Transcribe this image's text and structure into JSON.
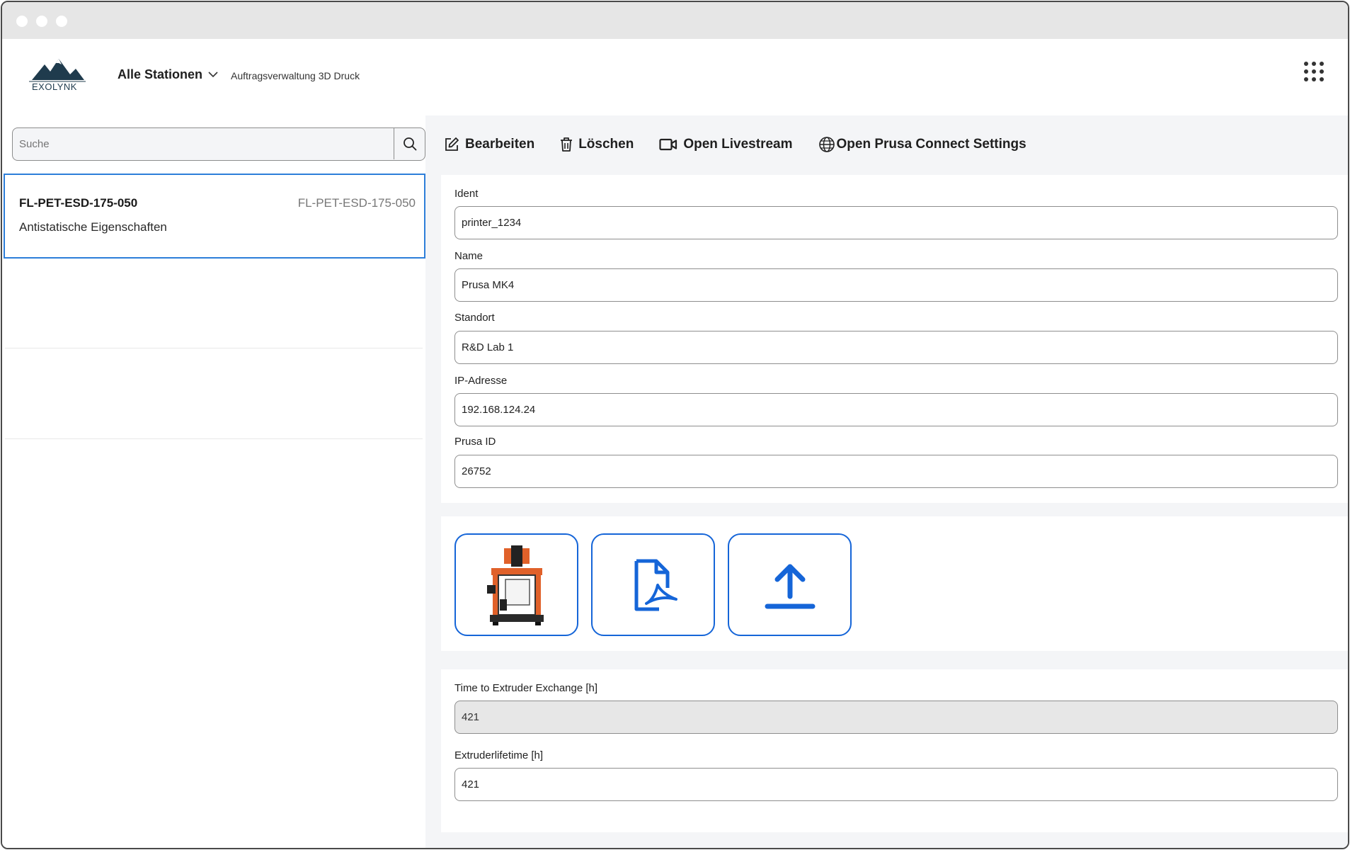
{
  "header": {
    "logo_text": "EXOLYNK",
    "station_selector": "Alle Stationen",
    "subtitle": "Auftragsverwaltung 3D Druck"
  },
  "search": {
    "placeholder": "Suche",
    "value": "Suche"
  },
  "list": {
    "items": [
      {
        "title": "FL-PET-ESD-175-050",
        "code": "FL-PET-ESD-175-050",
        "description": "Antistatische Eigenschaften"
      }
    ]
  },
  "toolbar": {
    "edit_label": "Bearbeiten",
    "delete_label": "Löschen",
    "livestream_label": "Open Livestream",
    "connect_label": "Open Prusa Connect Settings"
  },
  "details": {
    "ident_label": "Ident",
    "ident_value": "printer_1234",
    "name_label": "Name",
    "name_value": "Prusa MK4",
    "location_label": "Standort",
    "location_value": "R&D Lab 1",
    "ip_label": "IP-Adresse",
    "ip_value": "192.168.124.24",
    "prusa_id_label": "Prusa ID",
    "prusa_id_value": "26752"
  },
  "tiles": [
    {
      "icon": "3d-printer-image"
    },
    {
      "icon": "pdf-file-icon"
    },
    {
      "icon": "upload-icon"
    }
  ],
  "extruder": {
    "exchange_label": "Time to Extruder Exchange [h]",
    "exchange_value": "421",
    "lifetime_label": "Extruderlifetime [h]",
    "lifetime_value": "421"
  },
  "colors": {
    "accent": "#1565d8",
    "selection": "#2d7ed9",
    "panel_bg": "#f4f5f7",
    "logo": "#1f3b4d"
  }
}
